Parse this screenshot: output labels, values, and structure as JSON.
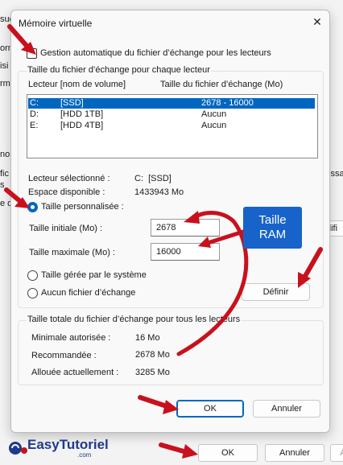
{
  "background_window": {
    "left_fragments": [
      "sue",
      "orn",
      "isi",
      "rm",
      "noi",
      "fic",
      "s",
      "e d"
    ],
    "right_fragments": [
      "issa",
      "difi"
    ],
    "ok_label": "OK",
    "cancel_label": "Annuler",
    "apply_label": "A"
  },
  "dialog": {
    "title": "Mémoire virtuelle",
    "close_glyph": "✕",
    "auto_manage_label": "Gestion automatique du fichier d’échange pour les lecteurs",
    "per_drive_group_label": "Taille du fichier d’échange pour chaque lecteur",
    "list_headers": {
      "drive": "Lecteur [nom de volume]",
      "size": "Taille du fichier d’échange (Mo)"
    },
    "drives": [
      {
        "letter": "C:",
        "volume": "[SSD]",
        "size": "2678 - 16000",
        "selected": true
      },
      {
        "letter": "D:",
        "volume": "[HDD 1TB]",
        "size": "Aucun",
        "selected": false
      },
      {
        "letter": "E:",
        "volume": "[HDD 4TB]",
        "size": "Aucun",
        "selected": false
      }
    ],
    "selected_drive_label": "Lecteur sélectionné :",
    "selected_drive_value": "C:  [SSD]",
    "free_space_label": "Espace disponible :",
    "free_space_value": "1433943 Mo",
    "custom_size_label": "Taille personnalisée :",
    "initial_size_label": "Taille initiale (Mo) :",
    "initial_size_value": "2678",
    "max_size_label": "Taille maximale (Mo) :",
    "max_size_value": "16000",
    "system_managed_label": "Taille gérée par le système",
    "no_paging_label": "Aucun fichier d’échange",
    "set_button_label": "Définir",
    "total_group_label": "Taille totale du fichier d’échange pour tous les lecteurs",
    "min_allowed_label": "Minimale autorisée :",
    "min_allowed_value": "16 Mo",
    "recommended_label": "Recommandée :",
    "recommended_value": "2678 Mo",
    "allocated_label": "Allouée actuellement :",
    "allocated_value": "3285 Mo",
    "ok_label": "OK",
    "cancel_label": "Annuler"
  },
  "annotation": {
    "callout_line1": "Taille",
    "callout_line2": "RAM",
    "arrow_color": "#c8111d",
    "callout_color": "#1763c9"
  },
  "brand": {
    "name": "EasyTutoriel",
    "domain": ".com"
  }
}
